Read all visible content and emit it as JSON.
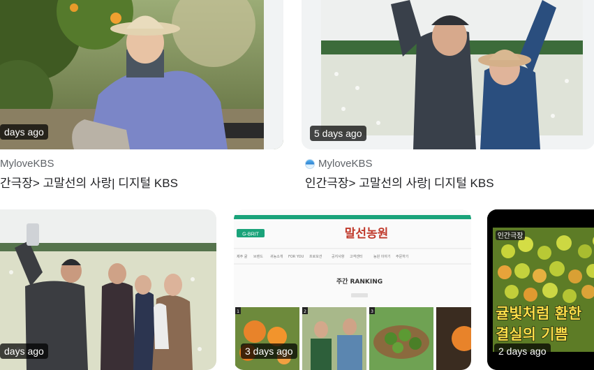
{
  "results": [
    {
      "duration": "days ago",
      "source": "MyloveKBS",
      "title": "간극장> 고말선의 사랑| 디지털 KBS"
    },
    {
      "duration": "5 days ago",
      "source": "MyloveKBS",
      "title": "인간극장> 고말선의 사랑| 디지털 KBS"
    },
    {
      "duration": "days ago"
    },
    {
      "duration": "3 days ago",
      "thumb_logo": "말선농원",
      "thumb_logo_tag": "G-BRIT",
      "thumb_heading": "주간 RANKING",
      "thumb_menu": [
        "제주 귤",
        "브랜드",
        "귀농소개",
        "FOR YOU",
        "프로모션",
        "공지사항",
        "고객센터",
        "농원 이야기",
        "주문하기"
      ],
      "thumb_rank_labels": [
        "1",
        "2",
        "3"
      ]
    },
    {
      "duration": "2 days ago",
      "thumb_tag": "인간극장",
      "thumb_caption_line1": "귤빛처럼 환한",
      "thumb_caption_line2": "결실의 기쁨"
    }
  ],
  "colors": {
    "accent_green": "#1aa37a",
    "logo_red": "#c0392b",
    "caption_yellow": "#ffe14a"
  }
}
